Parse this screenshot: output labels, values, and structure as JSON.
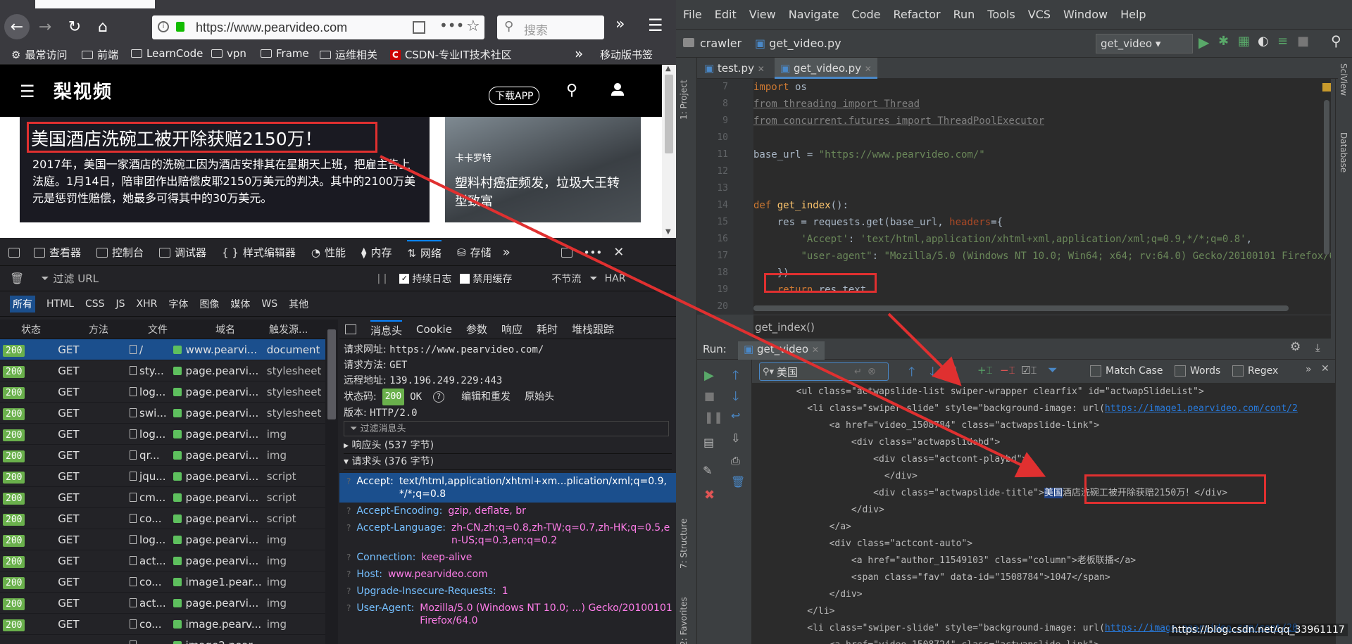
{
  "browser": {
    "url": "https://www.pearvideo.com",
    "search_placeholder": "搜索",
    "bookmarks": [
      "最常访问",
      "前端",
      "LearnCode",
      "vpn",
      "Frame",
      "运维相关",
      "CSDN-专业IT技术社区"
    ],
    "mobile_bookmarks": "移动版书签"
  },
  "site": {
    "logo": "梨视频",
    "download": "下载APP",
    "hero_title": "美国酒店洗碗工被开除获赔2150万！",
    "hero_text": "2017年，美国一家酒店的洗碗工因为酒店安排其在星期天上班，把雇主告上法庭。1月14日，陪审团作出赔偿皮耶2150万美元的判决。其中的2100万美元是惩罚性赔偿，她最多可得其中的30万美元。",
    "side_tag": "卡卡罗特",
    "side_title": "塑料村癌症频发，垃圾大王转型致富"
  },
  "devtools": {
    "tabs": [
      "查看器",
      "控制台",
      "调试器",
      "样式编辑器",
      "性能",
      "内存",
      "网络",
      "存储"
    ],
    "filter_placeholder": "过滤 URL",
    "persist": "持续日志",
    "disable_cache": "禁用缓存",
    "throttle": "不节流",
    "har": "HAR",
    "types": [
      "所有",
      "HTML",
      "CSS",
      "JS",
      "XHR",
      "字体",
      "图像",
      "媒体",
      "WS",
      "其他"
    ],
    "columns": [
      "状态",
      "方法",
      "文件",
      "域名",
      "触发源..."
    ],
    "rows": [
      {
        "status": "200",
        "method": "GET",
        "file": "/",
        "domain": "www.pearvi...",
        "cause": "document"
      },
      {
        "status": "200",
        "method": "GET",
        "file": "sty...",
        "domain": "page.pearvi...",
        "cause": "stylesheet"
      },
      {
        "status": "200",
        "method": "GET",
        "file": "log...",
        "domain": "page.pearvi...",
        "cause": "stylesheet"
      },
      {
        "status": "200",
        "method": "GET",
        "file": "swi...",
        "domain": "page.pearvi...",
        "cause": "stylesheet"
      },
      {
        "status": "200",
        "method": "GET",
        "file": "log...",
        "domain": "page.pearvi...",
        "cause": "img"
      },
      {
        "status": "200",
        "method": "GET",
        "file": "qr...",
        "domain": "page.pearvi...",
        "cause": "img"
      },
      {
        "status": "200",
        "method": "GET",
        "file": "jqu...",
        "domain": "page.pearvi...",
        "cause": "script"
      },
      {
        "status": "200",
        "method": "GET",
        "file": "cm...",
        "domain": "page.pearvi...",
        "cause": "script"
      },
      {
        "status": "200",
        "method": "GET",
        "file": "co...",
        "domain": "page.pearvi...",
        "cause": "script"
      },
      {
        "status": "200",
        "method": "GET",
        "file": "log...",
        "domain": "page.pearvi...",
        "cause": "img"
      },
      {
        "status": "200",
        "method": "GET",
        "file": "act...",
        "domain": "page.pearvi...",
        "cause": "img"
      },
      {
        "status": "200",
        "method": "GET",
        "file": "co...",
        "domain": "image1.pear...",
        "cause": "img"
      },
      {
        "status": "200",
        "method": "GET",
        "file": "act...",
        "domain": "page.pearvi...",
        "cause": "img"
      },
      {
        "status": "200",
        "method": "GET",
        "file": "co...",
        "domain": "image.pearv...",
        "cause": "img"
      },
      {
        "status": "",
        "method": "",
        "file": "",
        "domain": "image2.pear...",
        "cause": ""
      }
    ],
    "detail_tabs": [
      "消息头",
      "Cookie",
      "参数",
      "响应",
      "耗时",
      "堆栈跟踪"
    ],
    "req_url_label": "请求网址:",
    "req_url": "https://www.pearvideo.com/",
    "req_method_label": "请求方法:",
    "req_method": "GET",
    "remote_label": "远程地址:",
    "remote": "139.196.249.229:443",
    "status_label": "状态码:",
    "status_code": "200",
    "status_text": "OK",
    "edit_resend": "编辑和重发",
    "raw_headers": "原始头",
    "version_label": "版本:",
    "version": "HTTP/2.0",
    "filter_headers": "过滤消息头",
    "resp_headers": "响应头 (537 字节)",
    "req_headers": "请求头 (376 字节)",
    "headers": [
      {
        "k": "Accept:",
        "v": "text/html,application/xhtml+xm...plication/xml;q=0.9,*/*;q=0.8"
      },
      {
        "k": "Accept-Encoding:",
        "v": "gzip, deflate, br"
      },
      {
        "k": "Accept-Language:",
        "v": "zh-CN,zh;q=0.8,zh-TW;q=0.7,zh-HK;q=0.5,en-US;q=0.3,en;q=0.2"
      },
      {
        "k": "Connection:",
        "v": "keep-alive"
      },
      {
        "k": "Host:",
        "v": "www.pearvideo.com"
      },
      {
        "k": "Upgrade-Insecure-Requests:",
        "v": "1"
      },
      {
        "k": "User-Agent:",
        "v": "Mozilla/5.0 (Windows NT 10.0; ...) Gecko/20100101 Firefox/64.0"
      }
    ]
  },
  "ide": {
    "menu": [
      "File",
      "Edit",
      "View",
      "Navigate",
      "Code",
      "Refactor",
      "Run",
      "Tools",
      "VCS",
      "Window",
      "Help"
    ],
    "project": "crawler",
    "file": "get_video.py",
    "run_config": "get_video",
    "tabs": [
      "test.py",
      "get_video.py"
    ],
    "left_tool_1": "1: Project",
    "left_tool_2": "7: Structure",
    "left_tool_3": "2: Favorites",
    "right_tool_1": "SciView",
    "right_tool_2": "Database",
    "line_numbers": [
      "7",
      "8",
      "9",
      "10",
      "11",
      "12",
      "13",
      "14",
      "15",
      "16",
      "17",
      "18",
      "19",
      "20"
    ],
    "breadcrumb": "get_index()",
    "run_label": "Run:",
    "run_tab": "get_video",
    "find_value": "美国",
    "match_case": "Match Case",
    "words": "Words",
    "regex": "Regex",
    "watermark": "https://blog.csdn.net/qq_33961117"
  },
  "colors": {
    "accent": "#e03030",
    "status_ok": "#6ab04c",
    "select": "#1b4f8d"
  }
}
